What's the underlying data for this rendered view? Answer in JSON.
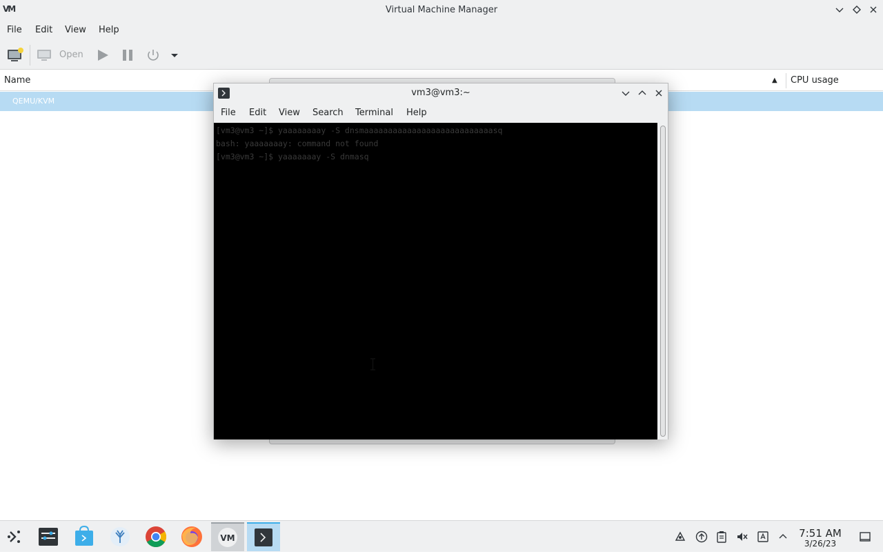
{
  "app": {
    "title": "Virtual Machine Manager",
    "logo_text": "VM"
  },
  "menubar": {
    "items": [
      "File",
      "Edit",
      "View",
      "Help"
    ]
  },
  "toolbar": {
    "open_label": "Open"
  },
  "list": {
    "col_name": "Name",
    "col_cpu": "CPU usage",
    "rows": [
      {
        "label": "QEMU/KVM",
        "selected": true
      }
    ]
  },
  "terminal": {
    "title": "vm3@vm3:~",
    "menu": [
      "File",
      "Edit",
      "View",
      "Search",
      "Terminal",
      "Help"
    ],
    "lines": [
      "[vm3@vm3 ~]$ yaaaaaaaay -S dnsmaaaaaaaaaaaaaaaaaaaaaaaaaaasq",
      "bash: yaaaaaaay: command not found",
      "[vm3@vm3 ~]$ yaaaaaaay -S dnmasq"
    ]
  },
  "taskbar": {
    "icons": [
      "app-launcher-icon",
      "system-settings-icon",
      "discover-store-icon",
      "plasma-icon",
      "chrome-icon",
      "firefox-icon",
      "virt-manager-icon",
      "konsole-icon"
    ],
    "tray": [
      "kde-connect-icon",
      "updates-icon",
      "clipboard-icon",
      "volume-muted-icon",
      "keyboard-layout-icon",
      "tray-expand-icon"
    ],
    "time": "7:51 AM",
    "date": "3/26/23"
  },
  "colors": {
    "selection": "#b7dbf3",
    "accent": "#3daee9",
    "terminal_bg": "#000000"
  }
}
